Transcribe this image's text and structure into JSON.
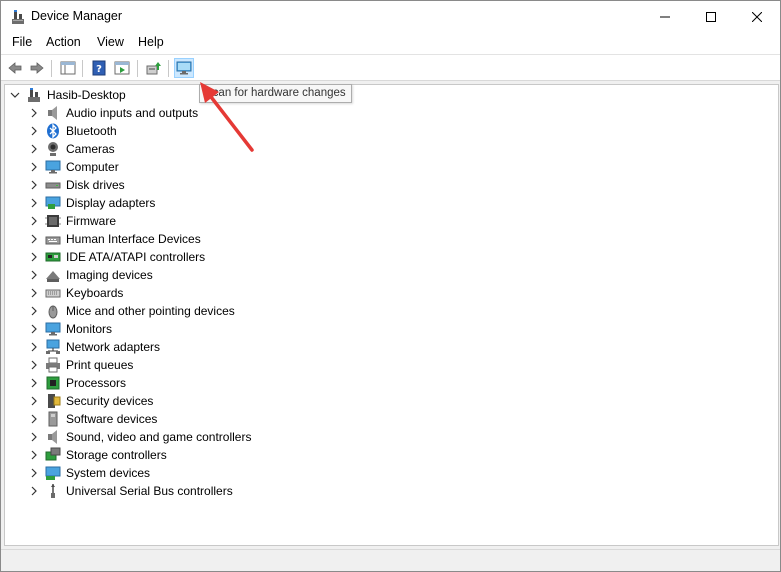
{
  "window": {
    "title": "Device Manager"
  },
  "menu": [
    {
      "label": "File"
    },
    {
      "label": "Action"
    },
    {
      "label": "View"
    },
    {
      "label": "Help"
    }
  ],
  "tooltip": "Scan for hardware changes",
  "tree": {
    "root": "Hasib-Desktop",
    "categories": [
      {
        "label": "Audio inputs and outputs",
        "icon": "speaker-icon"
      },
      {
        "label": "Bluetooth",
        "icon": "bluetooth-icon"
      },
      {
        "label": "Cameras",
        "icon": "camera-icon"
      },
      {
        "label": "Computer",
        "icon": "computer-icon"
      },
      {
        "label": "Disk drives",
        "icon": "disk-drive-icon"
      },
      {
        "label": "Display adapters",
        "icon": "display-adapter-icon"
      },
      {
        "label": "Firmware",
        "icon": "firmware-icon"
      },
      {
        "label": "Human Interface Devices",
        "icon": "hid-icon"
      },
      {
        "label": "IDE ATA/ATAPI controllers",
        "icon": "ide-controller-icon"
      },
      {
        "label": "Imaging devices",
        "icon": "imaging-icon"
      },
      {
        "label": "Keyboards",
        "icon": "keyboard-icon"
      },
      {
        "label": "Mice and other pointing devices",
        "icon": "mouse-icon"
      },
      {
        "label": "Monitors",
        "icon": "monitor-icon"
      },
      {
        "label": "Network adapters",
        "icon": "network-adapter-icon"
      },
      {
        "label": "Print queues",
        "icon": "printer-icon"
      },
      {
        "label": "Processors",
        "icon": "processor-icon"
      },
      {
        "label": "Security devices",
        "icon": "security-device-icon"
      },
      {
        "label": "Software devices",
        "icon": "software-device-icon"
      },
      {
        "label": "Sound, video and game controllers",
        "icon": "sound-icon"
      },
      {
        "label": "Storage controllers",
        "icon": "storage-controller-icon"
      },
      {
        "label": "System devices",
        "icon": "system-device-icon"
      },
      {
        "label": "Universal Serial Bus controllers",
        "icon": "usb-icon"
      }
    ]
  },
  "colors": {
    "accent": "#0078d7",
    "annotation_arrow": "#e53935",
    "tooltip_bg": "#f7f7f7"
  }
}
